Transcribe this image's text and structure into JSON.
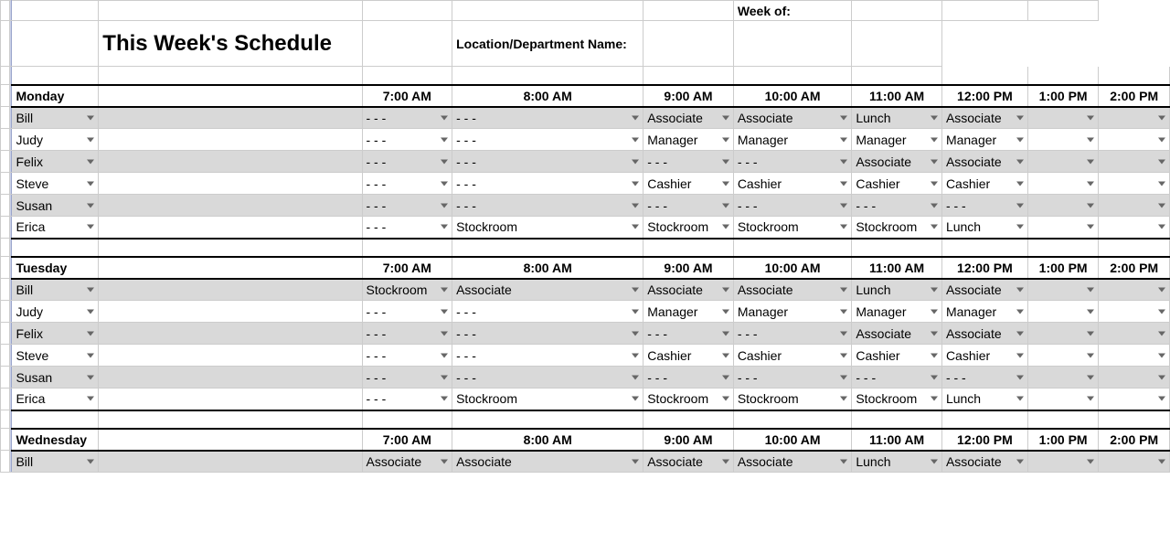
{
  "title": "This Week's Schedule",
  "meta": {
    "week_of_label": "Week of:",
    "location_label": "Location/Department Name:"
  },
  "time_headers": [
    "7:00 AM",
    "8:00 AM",
    "9:00 AM",
    "10:00 AM",
    "11:00 AM",
    "12:00 PM",
    "1:00 PM",
    "2:00 PM"
  ],
  "days": [
    {
      "name": "Monday",
      "rows": [
        {
          "emp": "Bill",
          "shaded": true,
          "slots": [
            "- - -",
            "- - -",
            "Associate",
            "Associate",
            "Lunch",
            "Associate",
            "",
            ""
          ]
        },
        {
          "emp": "Judy",
          "shaded": false,
          "slots": [
            "- - -",
            "- - -",
            "Manager",
            "Manager",
            "Manager",
            "Manager",
            "",
            ""
          ]
        },
        {
          "emp": "Felix",
          "shaded": true,
          "slots": [
            "- - -",
            "- - -",
            "- - -",
            "- - -",
            "Associate",
            "Associate",
            "",
            ""
          ]
        },
        {
          "emp": "Steve",
          "shaded": false,
          "slots": [
            "- - -",
            "- - -",
            "Cashier",
            "Cashier",
            "Cashier",
            "Cashier",
            "",
            ""
          ]
        },
        {
          "emp": "Susan",
          "shaded": true,
          "slots": [
            "- - -",
            "- - -",
            "- - -",
            "- - -",
            "- - -",
            "- - -",
            "",
            ""
          ]
        },
        {
          "emp": "Erica",
          "shaded": false,
          "slots": [
            "- - -",
            "Stockroom",
            "Stockroom",
            "Stockroom",
            "Stockroom",
            "Lunch",
            "",
            ""
          ]
        }
      ]
    },
    {
      "name": "Tuesday",
      "rows": [
        {
          "emp": "Bill",
          "shaded": true,
          "slots": [
            "Stockroom",
            "Associate",
            "Associate",
            "Associate",
            "Lunch",
            "Associate",
            "",
            ""
          ]
        },
        {
          "emp": "Judy",
          "shaded": false,
          "slots": [
            "- - -",
            "- - -",
            "Manager",
            "Manager",
            "Manager",
            "Manager",
            "",
            ""
          ]
        },
        {
          "emp": "Felix",
          "shaded": true,
          "slots": [
            "- - -",
            "- - -",
            "- - -",
            "- - -",
            "Associate",
            "Associate",
            "",
            ""
          ]
        },
        {
          "emp": "Steve",
          "shaded": false,
          "slots": [
            "- - -",
            "- - -",
            "Cashier",
            "Cashier",
            "Cashier",
            "Cashier",
            "",
            ""
          ]
        },
        {
          "emp": "Susan",
          "shaded": true,
          "slots": [
            "- - -",
            "- - -",
            "- - -",
            "- - -",
            "- - -",
            "- - -",
            "",
            ""
          ]
        },
        {
          "emp": "Erica",
          "shaded": false,
          "slots": [
            "- - -",
            "Stockroom",
            "Stockroom",
            "Stockroom",
            "Stockroom",
            "Lunch",
            "",
            ""
          ]
        }
      ]
    },
    {
      "name": "Wednesday",
      "rows": [
        {
          "emp": "Bill",
          "shaded": true,
          "slots": [
            "Associate",
            "Associate",
            "Associate",
            "Associate",
            "Lunch",
            "Associate",
            "",
            ""
          ]
        }
      ]
    }
  ]
}
